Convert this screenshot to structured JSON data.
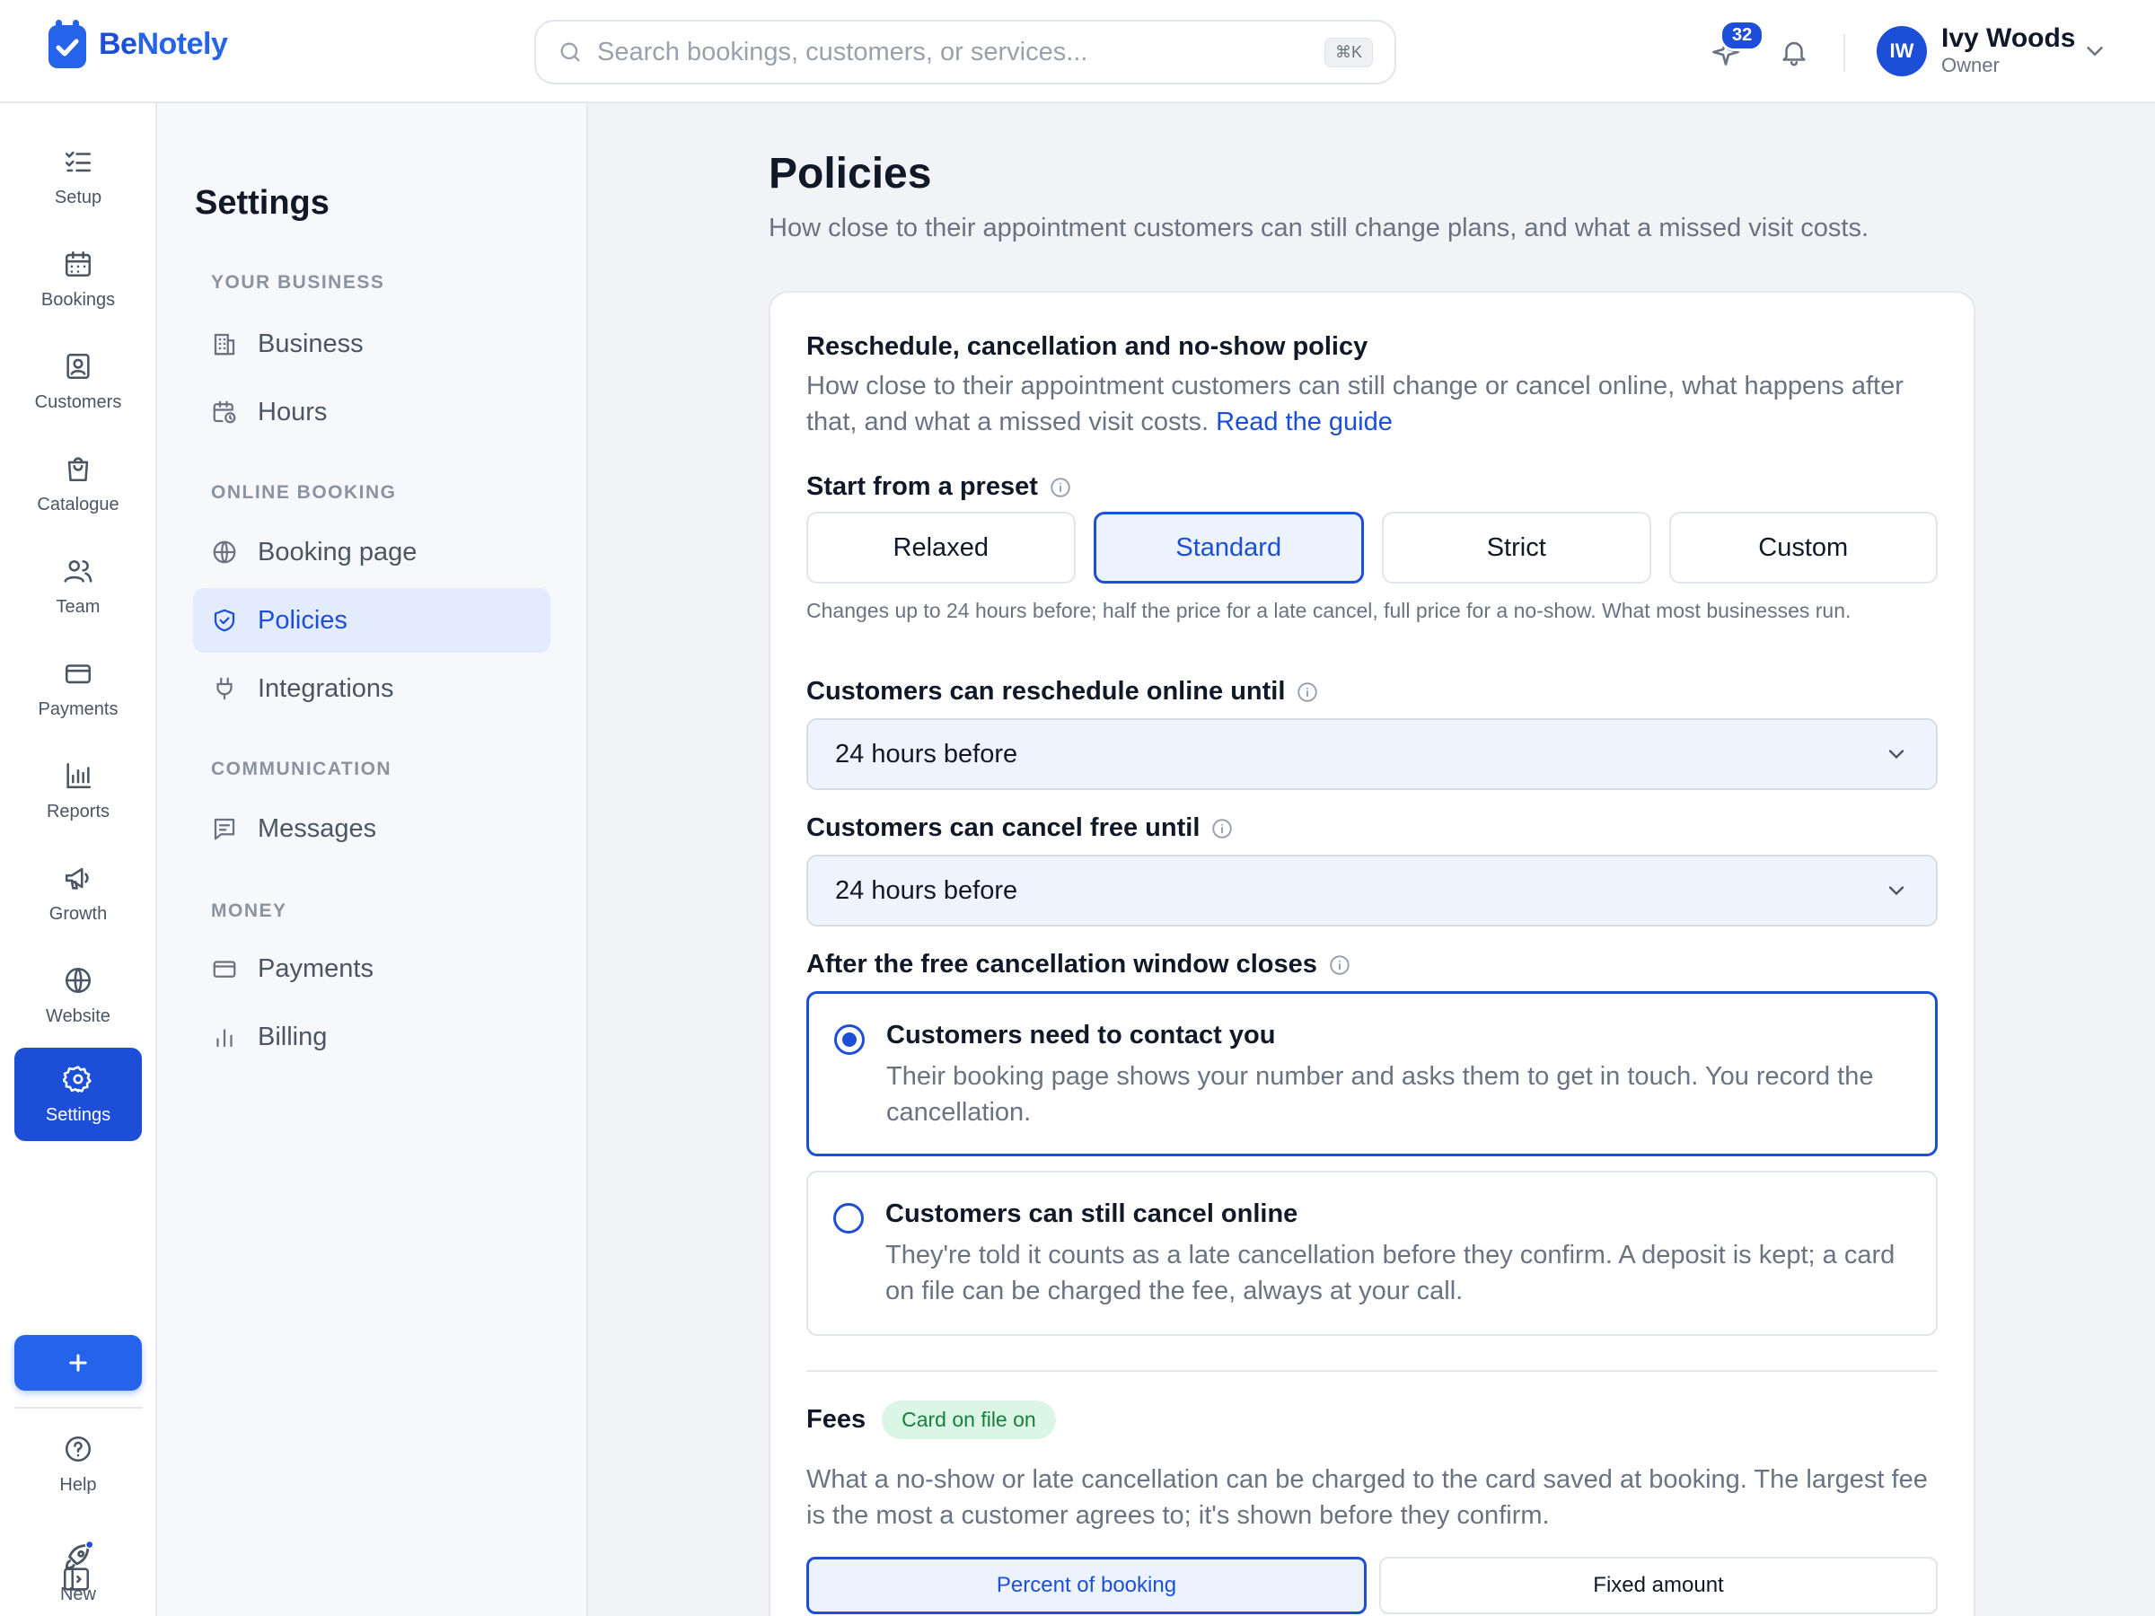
{
  "brand": {
    "name_part1": "Be",
    "name_part2": "Notely"
  },
  "search": {
    "placeholder": "Search bookings, customers, or services...",
    "shortcut": "⌘K"
  },
  "header": {
    "whats_new_count": "32",
    "user": {
      "initials": "IW",
      "name": "Ivy Woods",
      "role": "Owner"
    }
  },
  "rail": {
    "items": [
      {
        "label": "Setup",
        "icon": "checklist-icon"
      },
      {
        "label": "Bookings",
        "icon": "calendar-icon"
      },
      {
        "label": "Customers",
        "icon": "contact-card-icon"
      },
      {
        "label": "Catalogue",
        "icon": "shopping-bag-icon"
      },
      {
        "label": "Team",
        "icon": "users-icon"
      },
      {
        "label": "Payments",
        "icon": "credit-card-icon"
      },
      {
        "label": "Reports",
        "icon": "bar-chart-icon"
      },
      {
        "label": "Growth",
        "icon": "megaphone-icon"
      },
      {
        "label": "Website",
        "icon": "globe-icon"
      },
      {
        "label": "Settings",
        "icon": "gear-icon"
      }
    ],
    "bottom": [
      {
        "label": "Help",
        "icon": "help-circle-icon"
      },
      {
        "label": "New",
        "icon": "rocket-icon"
      }
    ]
  },
  "settings_nav": {
    "title": "Settings",
    "sections": [
      {
        "title": "YOUR BUSINESS",
        "items": [
          {
            "label": "Business",
            "icon": "building-icon"
          },
          {
            "label": "Hours",
            "icon": "calendar-clock-icon"
          }
        ]
      },
      {
        "title": "ONLINE BOOKING",
        "items": [
          {
            "label": "Booking page",
            "icon": "globe-icon"
          },
          {
            "label": "Policies",
            "icon": "shield-check-icon"
          },
          {
            "label": "Integrations",
            "icon": "plug-icon"
          }
        ]
      },
      {
        "title": "COMMUNICATION",
        "items": [
          {
            "label": "Messages",
            "icon": "message-icon"
          }
        ]
      },
      {
        "title": "MONEY",
        "items": [
          {
            "label": "Payments",
            "icon": "credit-card-icon"
          },
          {
            "label": "Billing",
            "icon": "bar-chart-icon"
          }
        ]
      }
    ]
  },
  "page": {
    "title": "Policies",
    "subtitle": "How close to their appointment customers can still change plans, and what a missed visit costs."
  },
  "policy": {
    "title": "Reschedule, cancellation and no-show policy",
    "description": "How close to their appointment customers can still change or cancel online, what happens after that, and what a missed visit costs.",
    "guide_link": "Read the guide",
    "preset_label": "Start from a preset",
    "presets": [
      "Relaxed",
      "Standard",
      "Strict",
      "Custom"
    ],
    "selected_preset": "Standard",
    "preset_note": "Changes up to 24 hours before; half the price for a late cancel, full price for a no-show. What most businesses run.",
    "reschedule_label": "Customers can reschedule online until",
    "reschedule_value": "24 hours before",
    "cancel_label": "Customers can cancel free until",
    "cancel_value": "24 hours before",
    "after_label": "After the free cancellation window closes",
    "options": [
      {
        "title": "Customers need to contact you",
        "desc": "Their booking page shows your number and asks them to get in touch. You record the cancellation.",
        "selected": true
      },
      {
        "title": "Customers can still cancel online",
        "desc": "They're told it counts as a late cancellation before they confirm. A deposit is kept; a card on file can be charged the fee, always at your call.",
        "selected": false
      }
    ]
  },
  "fees": {
    "title": "Fees",
    "badge": "Card on file on",
    "description": "What a no-show or late cancellation can be charged to the card saved at booking. The largest fee is the most a customer agrees to; it's shown before they confirm.",
    "modes": [
      "Percent of booking",
      "Fixed amount"
    ],
    "selected_mode": "Percent of booking"
  },
  "colors": {
    "accent": "#1d4ed8",
    "accent_light": "#edf3fe",
    "badge_green_bg": "#dcf6e6",
    "badge_green_text": "#15803d"
  }
}
